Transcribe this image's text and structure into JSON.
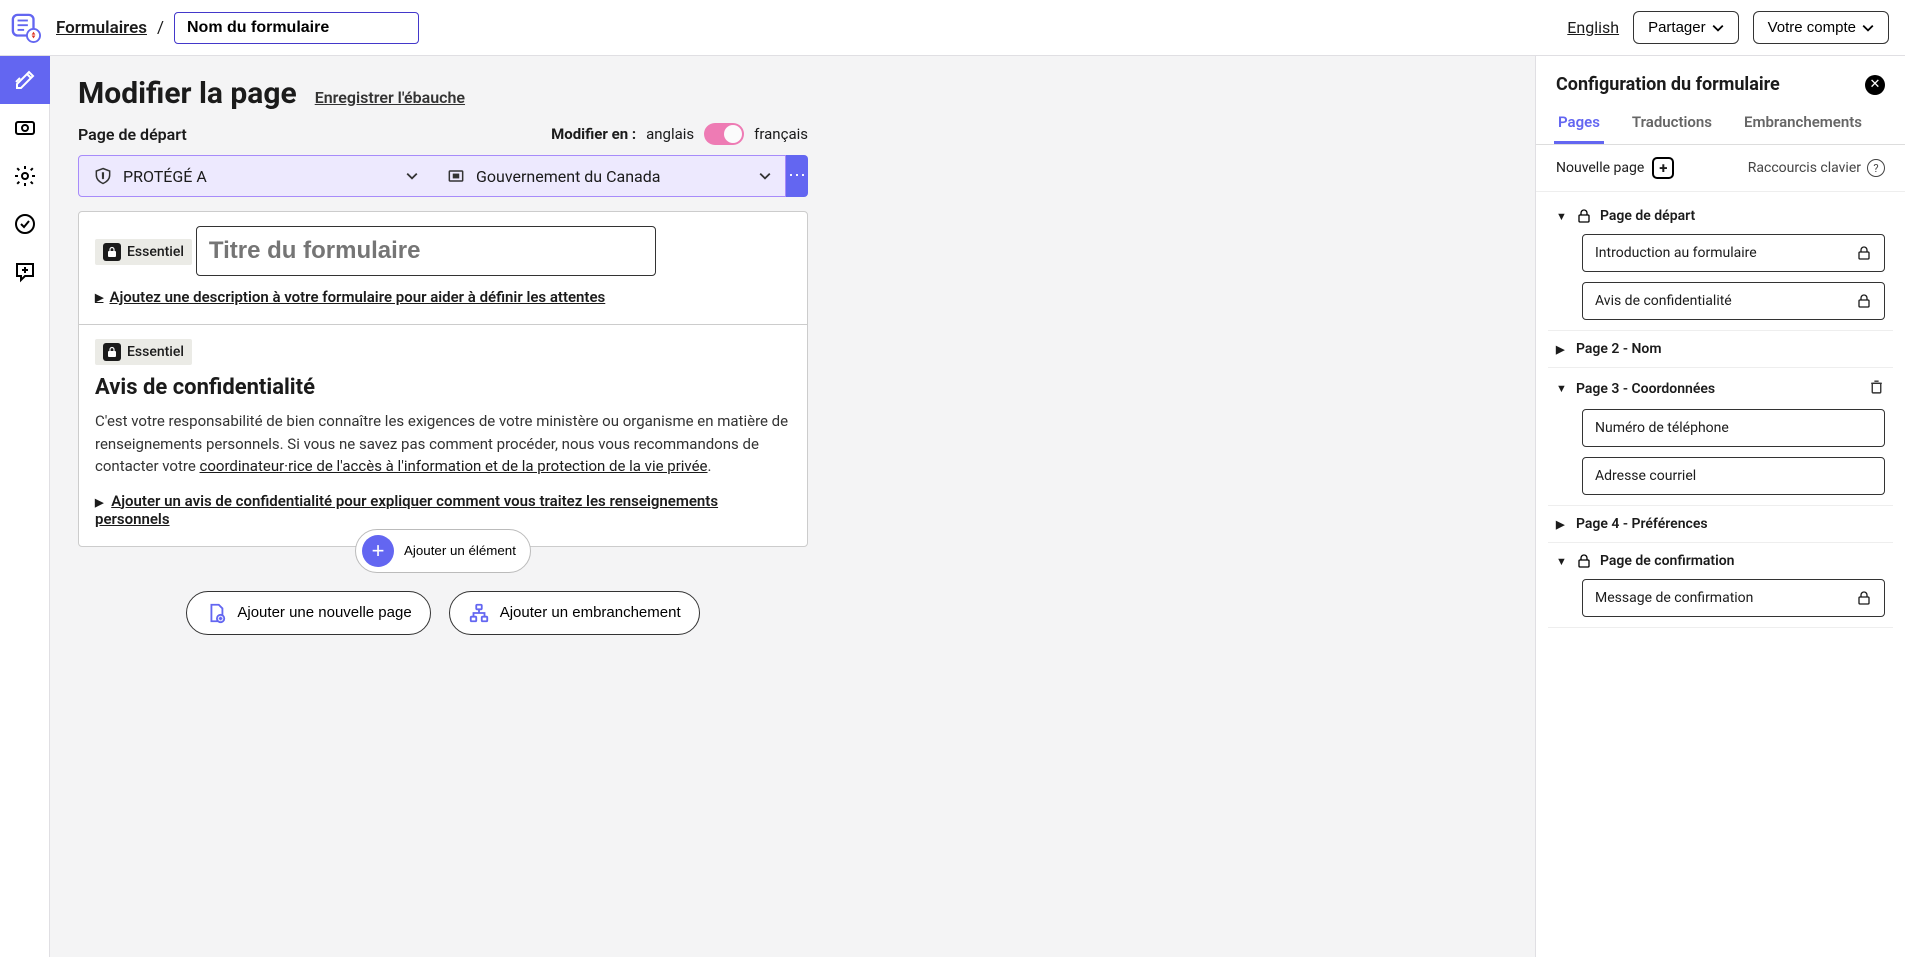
{
  "header": {
    "breadcrumb_root": "Formulaires",
    "form_name": "Nom du formulaire",
    "lang_link": "English",
    "share_btn": "Partager",
    "account_btn": "Votre compte"
  },
  "main": {
    "title": "Modifier la page",
    "save_draft": "Enregistrer l'ébauche",
    "start_page": "Page de départ",
    "edit_in_label": "Modifier en :",
    "lang_en": "anglais",
    "lang_fr": "français",
    "classification": "PROTÉGÉ A",
    "branding": "Gouvernement du Canada",
    "essential_badge": "Essentiel",
    "form_title_placeholder": "Titre du formulaire",
    "add_description": "Ajoutez une description à votre formulaire pour aider à définir les attentes",
    "privacy_title": "Avis de confidentialité",
    "privacy_body_1": "C'est votre responsabilité de bien connaître les exigences de votre ministère ou organisme en matière de renseignements personnels. Si vous ne savez pas comment procéder, nous vous recommandons de contacter votre ",
    "privacy_link": "coordinateur·rice de l'accès à l'information et de la protection de la vie privée",
    "privacy_disclosure": "Ajouter un avis de confidentialité pour expliquer comment vous traitez les renseignements personnels",
    "add_element": "Ajouter un élément",
    "add_new_page": "Ajouter une nouvelle page",
    "add_branching": "Ajouter un embranchement"
  },
  "panel": {
    "title": "Configuration du formulaire",
    "tab_pages": "Pages",
    "tab_translations": "Traductions",
    "tab_branching": "Embranchements",
    "new_page": "Nouvelle page",
    "shortcuts": "Raccourcis clavier",
    "nodes": {
      "start": "Page de départ",
      "start_intro": "Introduction au formulaire",
      "start_privacy": "Avis de confidentialité",
      "page2": "Page 2 - Nom",
      "page3": "Page 3 - Coordonnées",
      "page3_phone": "Numéro de téléphone",
      "page3_email": "Adresse courriel",
      "page4": "Page 4 - Préférences",
      "confirm": "Page de confirmation",
      "confirm_msg": "Message de confirmation"
    }
  }
}
